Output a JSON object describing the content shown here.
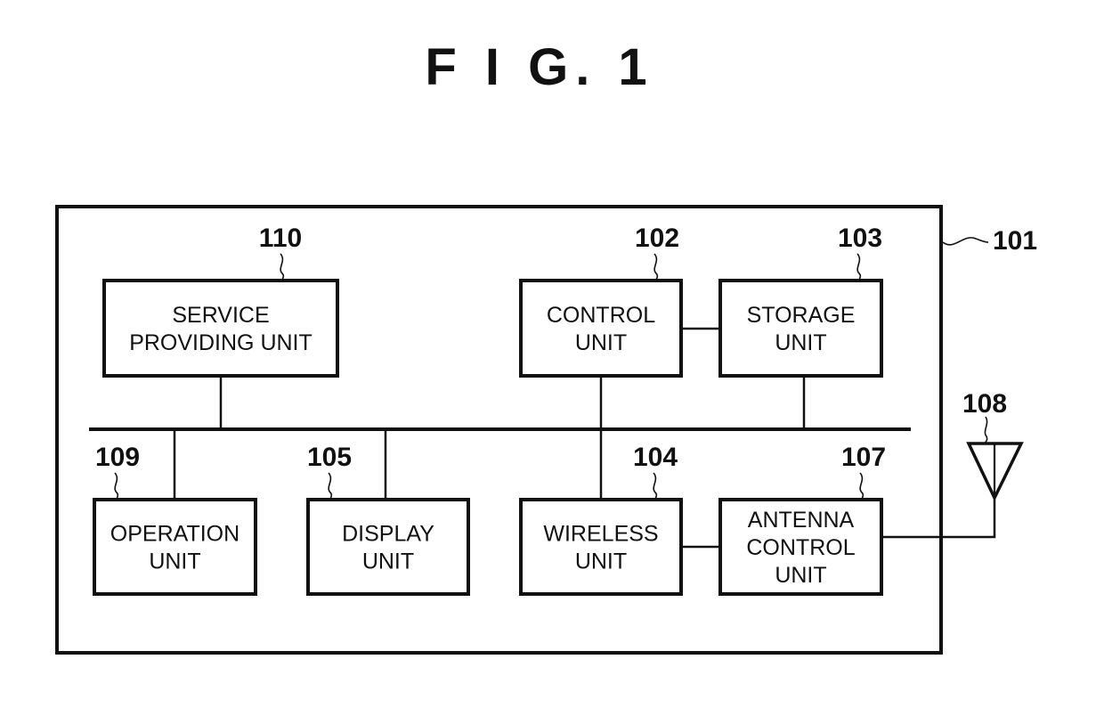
{
  "figure": {
    "title": "F I G. 1"
  },
  "device": {
    "ref": "101"
  },
  "units": [
    {
      "id": "service",
      "ref": "110",
      "lines": [
        "SERVICE",
        "PROVIDING UNIT"
      ]
    },
    {
      "id": "control",
      "ref": "102",
      "lines": [
        "CONTROL",
        "UNIT"
      ]
    },
    {
      "id": "storage",
      "ref": "103",
      "lines": [
        "STORAGE",
        "UNIT"
      ]
    },
    {
      "id": "operation",
      "ref": "109",
      "lines": [
        "OPERATION",
        "UNIT"
      ]
    },
    {
      "id": "display",
      "ref": "105",
      "lines": [
        "DISPLAY",
        "UNIT"
      ]
    },
    {
      "id": "wireless",
      "ref": "104",
      "lines": [
        "WIRELESS",
        "UNIT"
      ]
    },
    {
      "id": "antenna-control",
      "ref": "107",
      "lines": [
        "ANTENNA",
        "CONTROL",
        "UNIT"
      ]
    }
  ],
  "antenna": {
    "ref": "108"
  },
  "connections": [
    {
      "from": "control",
      "to": "storage"
    },
    {
      "from": "service",
      "to": "bus"
    },
    {
      "from": "control",
      "to": "bus"
    },
    {
      "from": "storage",
      "to": "bus"
    },
    {
      "from": "operation",
      "to": "bus"
    },
    {
      "from": "display",
      "to": "bus"
    },
    {
      "from": "wireless",
      "to": "control"
    },
    {
      "from": "wireless",
      "to": "antenna-control"
    },
    {
      "from": "antenna-control",
      "to": "antenna"
    }
  ]
}
